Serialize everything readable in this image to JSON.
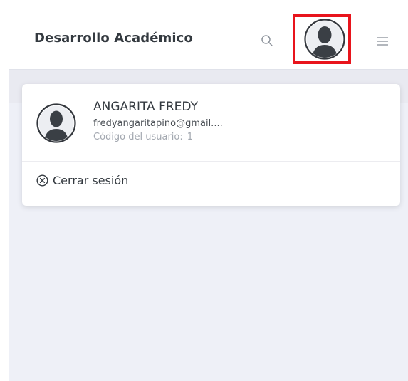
{
  "header": {
    "title": "Desarrollo Académico",
    "search_icon": "search-icon",
    "avatar_icon": "user-avatar-icon",
    "menu_icon": "hamburger-menu-icon",
    "highlight_color": "#e8141c"
  },
  "user_dropdown": {
    "name": "ANGARITA FREDY",
    "email": "fredyangaritapino@gmail....",
    "code_label": "Código del usuario:",
    "code_value": "1",
    "logout_icon": "close-circle-icon",
    "logout_label": "Cerrar sesión"
  }
}
